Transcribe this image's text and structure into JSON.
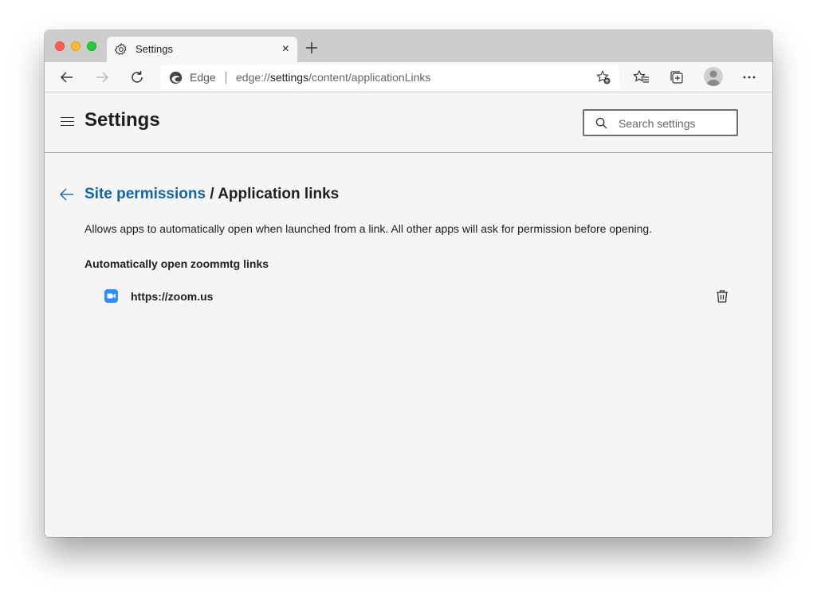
{
  "browser": {
    "tab": {
      "title": "Settings",
      "icon": "gear-icon",
      "close_glyph": "×"
    },
    "new_tab_icon": "plus-icon",
    "nav": {
      "back_icon": "arrow-left-icon",
      "forward_icon": "arrow-right-icon",
      "refresh_icon": "refresh-icon"
    },
    "omnibox": {
      "brand_label": "Edge",
      "url_prefix": "edge://",
      "url_host": "settings",
      "url_path": "/content/applicationLinks"
    },
    "toolbar_icons": [
      "add-favorite-icon",
      "favorites-icon",
      "collections-icon",
      "profile-avatar",
      "more-icon"
    ],
    "more_glyph": "···"
  },
  "settings": {
    "title": "Settings",
    "search": {
      "placeholder": "Search settings",
      "value": ""
    }
  },
  "page": {
    "breadcrumb_parent": "Site permissions",
    "breadcrumb_separator": " / ",
    "breadcrumb_current": "Application links",
    "description": "Allows apps to automatically open when launched from a link. All other apps will ask for permission before opening.",
    "section_title": "Automatically open zoommtg links",
    "sites": [
      {
        "url": "https://zoom.us",
        "favicon": "zoom-icon"
      }
    ]
  },
  "colors": {
    "link_blue": "#1264a3",
    "zoom_blue": "#2d8cff"
  }
}
